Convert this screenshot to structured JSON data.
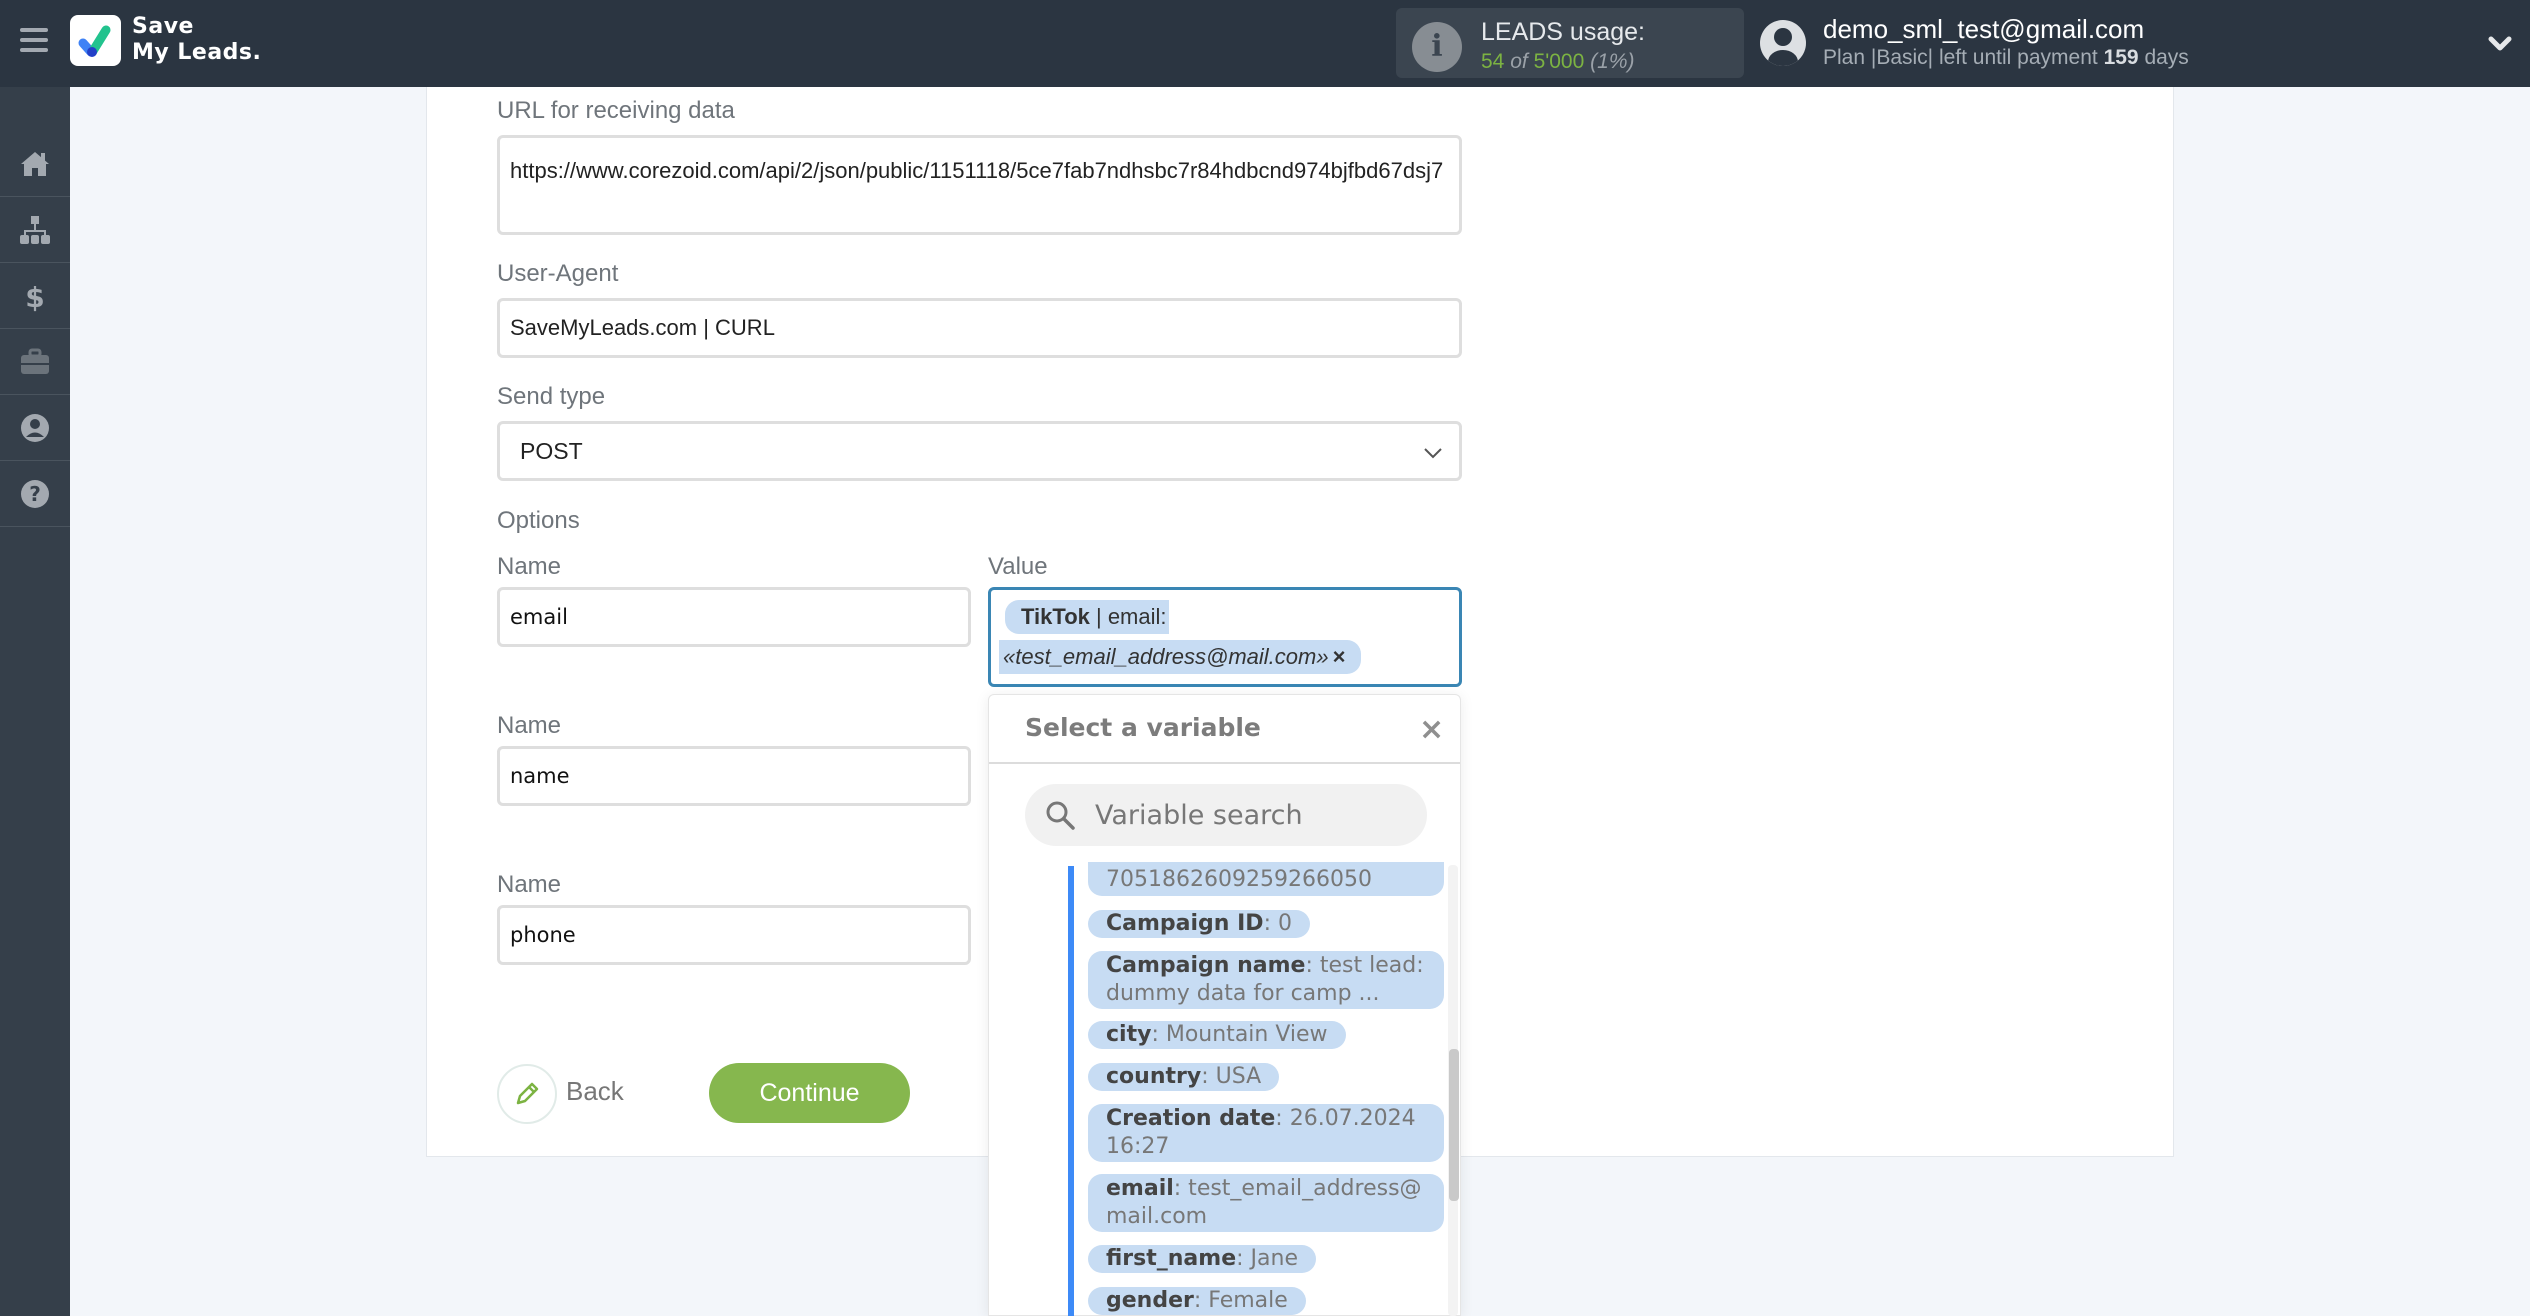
{
  "header": {
    "brand_line1": "Save",
    "brand_line2": "My Leads.",
    "usage_title": "LEADS usage:",
    "usage_used": "54",
    "usage_of": "of",
    "usage_total": "5'000",
    "usage_percent": "(1%)",
    "user_email": "demo_sml_test@gmail.com",
    "plan_prefix": "Plan |Basic| left until payment",
    "plan_days": "159",
    "plan_suffix": "days"
  },
  "sidebar": {
    "items": [
      {
        "name": "home",
        "icon": "home-icon"
      },
      {
        "name": "connections",
        "icon": "sitemap-icon"
      },
      {
        "name": "billing",
        "icon": "dollar-icon"
      },
      {
        "name": "tools",
        "icon": "briefcase-icon"
      },
      {
        "name": "account",
        "icon": "user-circle-icon"
      },
      {
        "name": "help",
        "icon": "question-circle-icon"
      }
    ]
  },
  "form": {
    "url_label": "URL for receiving data",
    "url_value": "https://www.corezoid.com/api/2/json/public/1151118/5ce7fab7ndhsbc7r84hdbcnd974bjfbd67dsj7",
    "user_agent_label": "User-Agent",
    "user_agent_value": "SaveMyLeads.com | CURL",
    "send_type_label": "Send type",
    "send_type_value": "POST",
    "options_label": "Options",
    "options": [
      {
        "name_label": "Name",
        "name_value": "email",
        "value_label": "Value",
        "value_chip_source": "TikTok",
        "value_chip_field": " | email:",
        "value_chip_data": "«test_email_address@mail.com»",
        "value_chip_remove": "×"
      },
      {
        "name_label": "Name",
        "name_value": "name"
      },
      {
        "name_label": "Name",
        "name_value": "phone"
      }
    ],
    "back_label": "Back",
    "continue_label": "Continue"
  },
  "dropdown": {
    "title": "Select a variable",
    "close": "×",
    "search_placeholder": "Variable search",
    "variables": [
      {
        "key": "",
        "value": "7051862609259266050"
      },
      {
        "key": "Campaign ID",
        "value": ": 0"
      },
      {
        "key": "Campaign name",
        "value": ": test lead: dummy data for camp ..."
      },
      {
        "key": "city",
        "value": ": Mountain View"
      },
      {
        "key": "country",
        "value": ": USA"
      },
      {
        "key": "Creation date",
        "value": ": 26.07.2024 16:27"
      },
      {
        "key": "email",
        "value": ": test_email_address@mail.com"
      },
      {
        "key": "first_name",
        "value": ": Jane"
      },
      {
        "key": "gender",
        "value": ": Female"
      }
    ]
  },
  "colors": {
    "header_bg": "#2b3541",
    "sidebar_bg": "#353f4a",
    "accent_green": "#86b74e",
    "chip_blue": "#c7dcf3",
    "focus_border": "#3a86b4",
    "list_bar": "#3d8af7"
  }
}
